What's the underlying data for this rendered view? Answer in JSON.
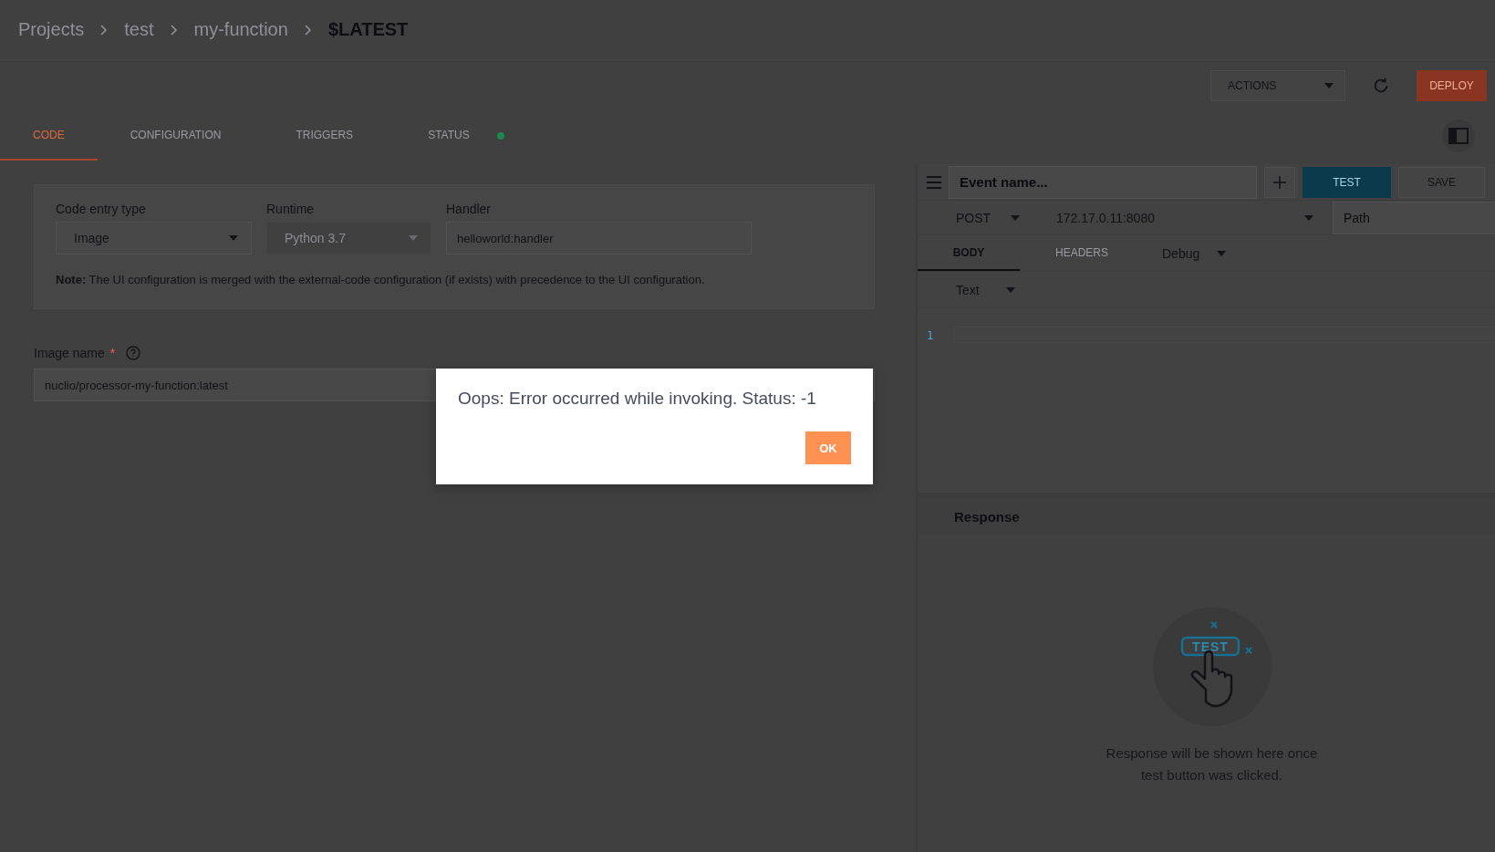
{
  "breadcrumbs": [
    "Projects",
    "test",
    "my-function",
    "$LATEST"
  ],
  "toolbar": {
    "actions": "ACTIONS",
    "deploy": "DEPLOY"
  },
  "tabs": [
    {
      "label": "CODE",
      "selected": true
    },
    {
      "label": "CONFIGURATION",
      "selected": false
    },
    {
      "label": "TRIGGERS",
      "selected": false
    },
    {
      "label": "STATUS",
      "selected": false,
      "color": "#1b8a50"
    }
  ],
  "code_entry": {
    "fields": [
      {
        "label": "Code entry type",
        "kind": "select",
        "value": "Image",
        "disabled": false
      },
      {
        "label": "Runtime",
        "kind": "select",
        "value": "Python 3.7",
        "disabled": true
      },
      {
        "label": "Handler",
        "kind": "input",
        "value": "helloworld:handler"
      }
    ],
    "note": "**Note:** The UI configuration is merged with the external-code configuration (if exists) with precedence to the UI configuration."
  },
  "image_name": {
    "label": "Image name",
    "required_mark": "*",
    "value": "nuclio/processor-my-function:latest"
  },
  "test_panel": {
    "event_name": {
      "placeholder": "Event name..."
    },
    "test": "TEST",
    "save": "SAVE",
    "method": "POST",
    "host": "172.17.0.11:8080",
    "path": {
      "placeholder": "Path"
    },
    "tabs": [
      {
        "label": "BODY",
        "selected": true
      },
      {
        "label": "HEADERS",
        "selected": false
      }
    ],
    "log_level": "Debug",
    "content_type": "Text",
    "line_numbers": [
      "1"
    ],
    "response": {
      "title": "Response",
      "illustration_label": "TEST",
      "message": "Response will be shown here once test button was clicked."
    }
  },
  "dialog": {
    "message": "Oops: Error occurred while invoking. Status: -1",
    "button": "OK"
  }
}
